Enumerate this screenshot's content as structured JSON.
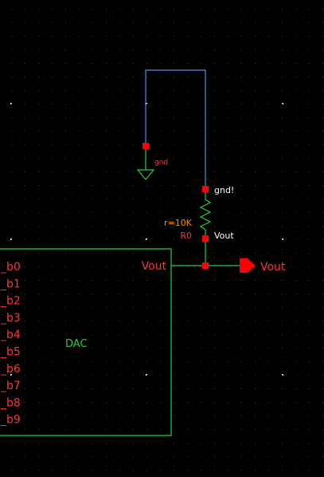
{
  "schematic": {
    "gnd_symbol_label": "gnd",
    "resistor_top_pin_label": "gnd!",
    "resistor_param": "r=10K",
    "resistor_name": "R0",
    "resistor_bottom_pin_label": "Vout",
    "output_pin_label": "Vout",
    "dac": {
      "name": "DAC",
      "output_label": "Vout",
      "pins": [
        "_b0",
        "_b1",
        "_b2",
        "_b3",
        "_b4",
        "_b5",
        "_b6",
        "_b7",
        "_b8",
        "_b9"
      ]
    }
  },
  "colors": {
    "background": "#000000",
    "grid_dot": "#ffffff",
    "wire": "#4a90e2",
    "pin": "#ff0000",
    "label": "#ff3333",
    "resistor": "#2ecc40",
    "instance_box": "#2ecc40",
    "param_text": "#ff8c00",
    "vout_text": "#ffffff"
  }
}
